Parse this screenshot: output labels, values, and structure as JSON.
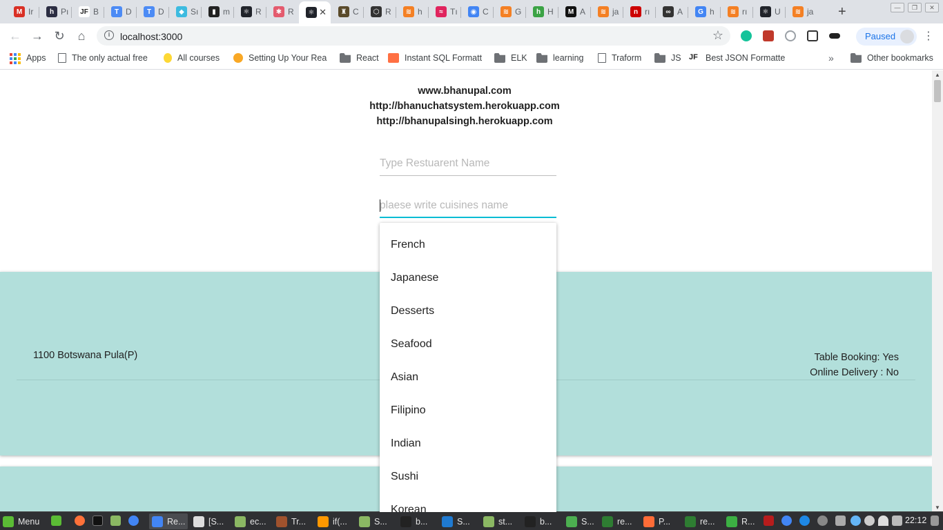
{
  "browser": {
    "tabs": [
      {
        "label": "Ir",
        "icon": "gmail-icon",
        "color": "#d93025",
        "glyph": "M"
      },
      {
        "label": "Pı",
        "icon": "hashnode-icon",
        "color": "#2b2d42",
        "glyph": "h"
      },
      {
        "label": "B",
        "icon": "jf-icon",
        "color": "#ffffff",
        "glyph": "JF"
      },
      {
        "label": "D",
        "icon": "t-icon",
        "color": "#4c8bf5",
        "glyph": "T"
      },
      {
        "label": "D",
        "icon": "t-icon",
        "color": "#4c8bf5",
        "glyph": "T"
      },
      {
        "label": "Sı",
        "icon": "bird-icon",
        "color": "#3dbbe0",
        "glyph": "◆"
      },
      {
        "label": "m",
        "icon": "medium-icon",
        "color": "#222222",
        "glyph": "▮"
      },
      {
        "label": "R",
        "icon": "react-icon",
        "color": "#20232a",
        "glyph": "⚛"
      },
      {
        "label": "R",
        "icon": "react-icon",
        "color": "#e45b6e",
        "glyph": "✱"
      },
      {
        "label": "",
        "icon": "react-icon",
        "color": "#20232a",
        "glyph": "⚛"
      },
      {
        "label": "C",
        "icon": "chef-icon",
        "color": "#5a4a2a",
        "glyph": "♜"
      },
      {
        "label": "R",
        "icon": "codesandbox-icon",
        "color": "#333333",
        "glyph": "⬡"
      },
      {
        "label": "h",
        "icon": "stackoverflow-icon",
        "color": "#f48024",
        "glyph": "≋"
      },
      {
        "label": "Tı",
        "icon": "wave-icon",
        "color": "#e0245e",
        "glyph": "≈"
      },
      {
        "label": "C",
        "icon": "circle-icon",
        "color": "#4285f4",
        "glyph": "◉"
      },
      {
        "label": "G",
        "icon": "stackoverflow-icon",
        "color": "#f48024",
        "glyph": "≋"
      },
      {
        "label": "H",
        "icon": "h-icon",
        "color": "#3ba345",
        "glyph": "h"
      },
      {
        "label": "A",
        "icon": "medium-icon",
        "color": "#111111",
        "glyph": "M"
      },
      {
        "label": "ja",
        "icon": "stackoverflow-icon",
        "color": "#f48024",
        "glyph": "≋"
      },
      {
        "label": "rı",
        "icon": "n-icon",
        "color": "#cc0000",
        "glyph": "n"
      },
      {
        "label": "A",
        "icon": "infinity-icon",
        "color": "#333333",
        "glyph": "∞"
      },
      {
        "label": "h",
        "icon": "google-icon",
        "color": "#4285f4",
        "glyph": "G"
      },
      {
        "label": "rı",
        "icon": "stackoverflow-icon",
        "color": "#f48024",
        "glyph": "≋"
      },
      {
        "label": "U",
        "icon": "react-icon",
        "color": "#20232a",
        "glyph": "⚛"
      },
      {
        "label": "ja",
        "icon": "stackoverflow-icon",
        "color": "#f48024",
        "glyph": "≋"
      }
    ],
    "active_tab_index": 9,
    "new_tab_glyph": "+",
    "url": "localhost:3000",
    "profile_label": "Paused"
  },
  "bookmarks": [
    {
      "label": "Apps",
      "icon": "apps-grid-icon",
      "type": "apps"
    },
    {
      "label": "The only actual free",
      "icon": "page-icon",
      "type": "page"
    },
    {
      "label": "All courses",
      "icon": "bulb-icon",
      "type": "bulb"
    },
    {
      "label": "Setting Up Your Rea",
      "icon": "lemon-icon",
      "type": "lemon"
    },
    {
      "label": "React",
      "icon": "folder-icon",
      "type": "folder"
    },
    {
      "label": "Instant SQL Formatt",
      "icon": "sql-icon",
      "type": "sql"
    },
    {
      "label": "ELK",
      "icon": "folder-icon",
      "type": "folder"
    },
    {
      "label": "learning",
      "icon": "folder-icon",
      "type": "folder"
    },
    {
      "label": "Traform",
      "icon": "page-icon",
      "type": "page"
    },
    {
      "label": "JS",
      "icon": "folder-icon",
      "type": "folder"
    },
    {
      "label": "Best JSON Formatte",
      "icon": "jf-icon",
      "type": "jf"
    }
  ],
  "other_bookmarks": "Other bookmarks",
  "page": {
    "links": [
      "www.bhanupal.com",
      "http://bhanuchatsystem.herokuapp.com",
      "http://bhanupalsingh.herokuapp.com"
    ],
    "restaurant_placeholder": "Type Restuarent Name",
    "cuisine_placeholder": "plaese write cuisines name",
    "cuisine_options": [
      "French",
      "Japanese",
      "Desserts",
      "Seafood",
      "Asian",
      "Filipino",
      "Indian",
      "Sushi",
      "Korean"
    ],
    "card": {
      "cost": "1100 Botswana Pula(P)",
      "table_booking": "Table Booking: Yes",
      "online_delivery": "Online Delivery : No"
    }
  },
  "taskbar": {
    "menu_label": "Menu",
    "windows": [
      {
        "label": "Re...",
        "icon": "chrome-icon",
        "color": "#4285f4"
      },
      {
        "label": "[S...",
        "icon": "settings-icon",
        "color": "#dddddd"
      },
      {
        "label": "ec...",
        "icon": "folder-icon",
        "color": "#8bb863"
      },
      {
        "label": "Tr...",
        "icon": "gear-icon",
        "color": "#a0522d"
      },
      {
        "label": "if(...",
        "icon": "sublime-icon",
        "color": "#ff9800"
      },
      {
        "label": "S...",
        "icon": "folder-icon",
        "color": "#8bb863"
      },
      {
        "label": "b...",
        "icon": "terminal-icon",
        "color": "#222222"
      },
      {
        "label": "S...",
        "icon": "vscode-icon",
        "color": "#1f7ad1"
      },
      {
        "label": "st...",
        "icon": "folder-icon",
        "color": "#8bb863"
      },
      {
        "label": "b...",
        "icon": "terminal-icon",
        "color": "#222222"
      },
      {
        "label": "S...",
        "icon": "calc-icon",
        "color": "#4caf50"
      },
      {
        "label": "re...",
        "icon": "spreadsheet-icon",
        "color": "#2e7d32"
      },
      {
        "label": "P...",
        "icon": "postman-icon",
        "color": "#ff6c37"
      },
      {
        "label": "re...",
        "icon": "spreadsheet-icon",
        "color": "#2e7d32"
      },
      {
        "label": "R...",
        "icon": "robo-icon",
        "color": "#3cb043"
      }
    ],
    "clock": "22:12"
  }
}
